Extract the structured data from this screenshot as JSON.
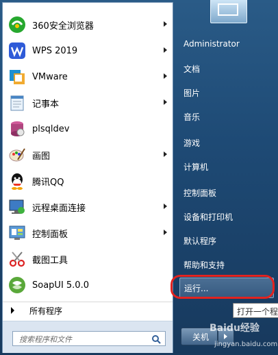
{
  "programs": [
    {
      "label": "360安全浏览器",
      "icon": "360-browser-icon",
      "arrow": true
    },
    {
      "label": "WPS 2019",
      "icon": "wps-icon",
      "arrow": true
    },
    {
      "label": "VMware",
      "icon": "vmware-icon",
      "arrow": true
    },
    {
      "label": "记事本",
      "icon": "notepad-icon",
      "arrow": true
    },
    {
      "label": "plsqldev",
      "icon": "plsqldev-icon",
      "arrow": false
    },
    {
      "label": "画图",
      "icon": "paint-icon",
      "arrow": true
    },
    {
      "label": "腾讯QQ",
      "icon": "qq-icon",
      "arrow": false
    },
    {
      "label": "远程桌面连接",
      "icon": "remote-desktop-icon",
      "arrow": true
    },
    {
      "label": "控制面板",
      "icon": "control-panel-icon",
      "arrow": true
    },
    {
      "label": "截图工具",
      "icon": "snipping-tool-icon",
      "arrow": false
    },
    {
      "label": "SoapUI 5.0.0",
      "icon": "soapui-icon",
      "arrow": false
    }
  ],
  "all_programs": "所有程序",
  "search": {
    "placeholder": "搜索程序和文件"
  },
  "right_items": [
    {
      "label": "Administrator"
    },
    {
      "label": "文档"
    },
    {
      "label": "图片"
    },
    {
      "label": "音乐"
    },
    {
      "label": "游戏"
    },
    {
      "label": "计算机"
    },
    {
      "label": "控制面板"
    },
    {
      "label": "设备和打印机"
    },
    {
      "label": "默认程序"
    },
    {
      "label": "帮助和支持"
    },
    {
      "label": "运行..."
    }
  ],
  "shutdown": {
    "label": "关机"
  },
  "tooltip": "打开一个程",
  "watermark": {
    "text": "Baidu经验",
    "sub": "jingyan.baidu.com"
  },
  "colors": {
    "highlight_circle": "#e3231f",
    "menu_bg": "#1e4a75"
  }
}
